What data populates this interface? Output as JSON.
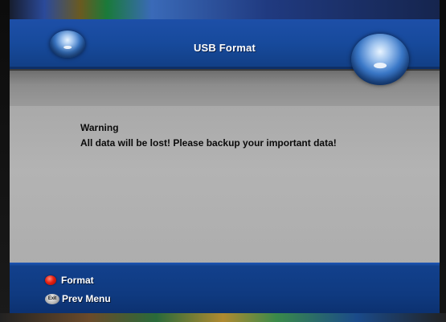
{
  "header": {
    "title": "USB Format"
  },
  "dialog": {
    "warning_title": "Warning",
    "warning_message": "All data will be lost! Please backup your important data!"
  },
  "footer": {
    "hints": [
      {
        "key_icon": "red-button-icon",
        "label": "Format"
      },
      {
        "key_icon": "exit-button-icon",
        "key_text": "Exit",
        "label": "Prev Menu"
      }
    ]
  },
  "colors": {
    "header_blue": "#174a9c",
    "body_gray": "#b0b0b0",
    "footer_blue": "#0f3a80",
    "text_dark": "#0b0b0b",
    "key_red": "#e62010"
  }
}
